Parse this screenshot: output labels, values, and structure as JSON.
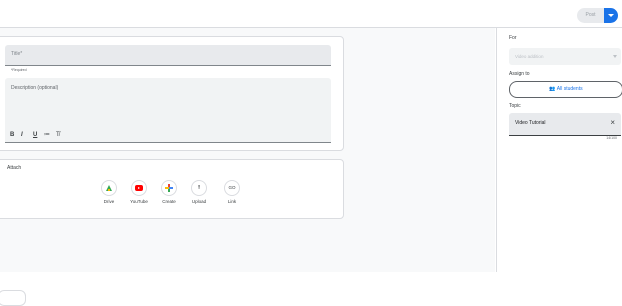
{
  "toolbar": {
    "post_label": "Post"
  },
  "form": {
    "title_placeholder": "Title*",
    "required_note": "*Required",
    "description_placeholder": "Description (optional)",
    "format_tools": [
      "B",
      "I",
      "U",
      "≔",
      "T̸"
    ]
  },
  "attach": {
    "label": "Attach",
    "items": [
      {
        "label": "Drive",
        "icon": "drive-icon"
      },
      {
        "label": "YouTube",
        "icon": "youtube-icon"
      },
      {
        "label": "Create",
        "icon": "create-plus-icon"
      },
      {
        "label": "Upload",
        "icon": "upload-icon",
        "glyph": "⭱"
      },
      {
        "label": "Link",
        "icon": "link-icon",
        "glyph": "GO"
      }
    ]
  },
  "sidebar": {
    "for_label": "For",
    "class_value": "Video addition",
    "assign_label": "Assign to",
    "all_students": "All students",
    "topic_label": "Topic",
    "topic_value": "Video Tutorial",
    "topic_counter": "14/100",
    "student_icon": "👥"
  },
  "colors": {
    "accent": "#1a73e8",
    "youtube": "#ff0000"
  }
}
